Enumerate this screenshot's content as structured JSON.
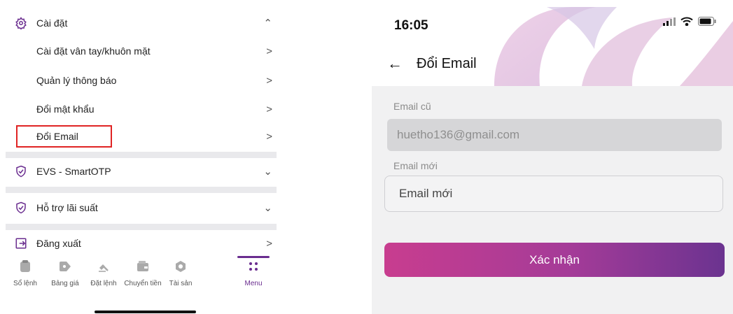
{
  "settings_menu": {
    "section_settings": {
      "label": "Cài đặt",
      "items": [
        {
          "label": "Cài đặt vân tay/khuôn mặt"
        },
        {
          "label": "Quản lý thông báo"
        },
        {
          "label": "Đổi mật khẩu"
        },
        {
          "label": "Đổi Email"
        }
      ]
    },
    "section_evs": {
      "label": "EVS - SmartOTP"
    },
    "section_support": {
      "label": "Hỗ trợ lãi suất"
    },
    "logout": {
      "label": "Đăng xuất"
    },
    "highlight_color": "#e02424"
  },
  "bottom_nav": {
    "items": [
      {
        "label": "Sổ lệnh",
        "icon": "clipboard-icon"
      },
      {
        "label": "Bảng giá",
        "icon": "price-tag-icon"
      },
      {
        "label": "Đặt lệnh",
        "icon": "hammer-icon"
      },
      {
        "label": "Chuyển tiền",
        "icon": "wallet-icon"
      },
      {
        "label": "Tài sản",
        "icon": "asset-icon"
      },
      {
        "label": "Menu",
        "icon": "menu-dots-icon"
      }
    ],
    "active": "Menu",
    "accent_color": "#6a2d8f"
  },
  "change_email_screen": {
    "status_time": "16:05",
    "title": "Đổi Email",
    "old_email_label": "Email cũ",
    "old_email_value": "huetho136@gmail.com",
    "new_email_label": "Email mới",
    "new_email_placeholder": "Email mới",
    "submit_label": "Xác nhận"
  }
}
